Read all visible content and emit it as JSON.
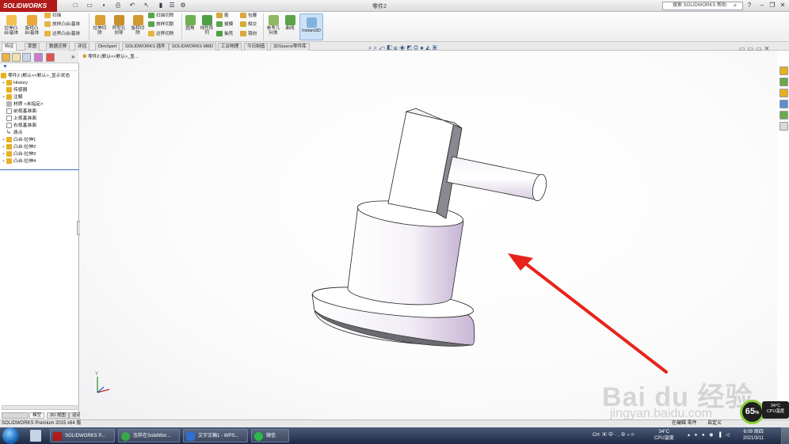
{
  "app": {
    "logo_text": "SOLIDWORKS",
    "document_title": "零件2",
    "help_search_placeholder": "搜索 SOLIDWORKS 帮助"
  },
  "ribbon": {
    "buttons": [
      {
        "label": "拉伸凸\n台/基体"
      },
      {
        "label": "旋转凸\n台/基体"
      },
      {
        "label": "拉伸切\n除"
      },
      {
        "label": "异型孔\n向导"
      },
      {
        "label": "旋转切\n除"
      },
      {
        "label": "圆角"
      },
      {
        "label": "线性阵\n列"
      },
      {
        "label": "参考几\n何体"
      },
      {
        "label": "曲线"
      },
      {
        "label": "Instant3D"
      }
    ],
    "small": {
      "sweep": "扫描",
      "loft": "放样凸台/基体",
      "boundary": "边界凸台/基体",
      "swept_cut": "扫描切除",
      "loft_cut": "放样切割",
      "boundary_cut": "边界切除",
      "rib": "筋",
      "draft": "拔模",
      "shell": "抽壳",
      "wrap": "包覆",
      "intersect": "相交",
      "mirror": "镜向"
    }
  },
  "tabs": [
    "特征",
    "草图",
    "数据迁移",
    "评估",
    "DimXpert",
    "SOLIDWORKS 插件",
    "SOLIDWORKS MBD",
    "工业物理",
    "今日制造",
    "3DSource零件库"
  ],
  "breadcrumb": "零件2 (默认<<默认>_显...",
  "tree": {
    "root": "零件2 (默认<<默认>_显示状态",
    "items": [
      "History",
      "传感器",
      "注解",
      "材质 <未指定>",
      "前视基准面",
      "上视基准面",
      "右视基准面",
      "原点",
      "凸台-拉伸1",
      "凸台-拉伸2",
      "凸台-拉伸3",
      "凸台-拉伸4"
    ]
  },
  "bottom_tabs": [
    "模型",
    "3D 视图",
    "运动算例 1"
  ],
  "status": {
    "left": "SOLIDWORKS Premium 2015 x64 版",
    "editing": "在编辑 零件",
    "custom": "自定义"
  },
  "taskbar": {
    "items": [
      "SOLIDWORKS P...",
      "怎样在SolidWor...",
      "文字文稿1 - WPS...",
      "微信"
    ],
    "temp": "34°C",
    "cpu_label": "CPU温度",
    "time": "6:09 周四",
    "date": "2021/3/11",
    "lang": "CH"
  },
  "overlay": {
    "gauge_value": "65",
    "gauge_unit": "%",
    "temp": "34°C",
    "cpu_label": "CPU温度",
    "watermark": "Bai du 经验",
    "watermark_url": "jingyan.baidu.com"
  },
  "colors": {
    "logo_bg": "#b01a1a",
    "arrow": "#e8231a",
    "model_face": "#ffffff",
    "model_shade": "#c9b8d6",
    "tree_icon": "#e7b020"
  }
}
